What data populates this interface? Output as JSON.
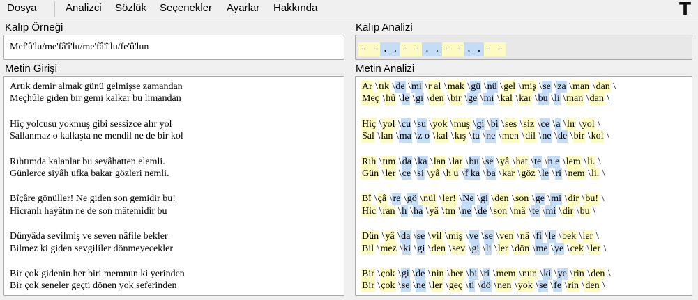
{
  "menu": {
    "items": [
      "Dosya",
      "Analizci",
      "Sözlük",
      "Seçenekler",
      "Ayarlar",
      "Hakkında"
    ],
    "right_icon": "T"
  },
  "kalip_ornegi": {
    "label": "Kalıp Örneği",
    "value": "Mef'û'lu/me'fâ'î'lu/me'fâ'î'lu/fe'û'lun"
  },
  "kalip_analizi": {
    "label": "Kalıp Analizi",
    "pattern": [
      "- -",
      ".",
      ".",
      "- -",
      ".",
      ".",
      "- -",
      ".",
      ".",
      "- -"
    ]
  },
  "metin_girisi": {
    "label": "Metin Girişi",
    "stanzas": [
      [
        "Artık demir almak günü gelmişse zamandan",
        "Meçhûle giden bir gemi kalkar bu limandan"
      ],
      [
        "Hiç yolcusu yokmuş gibi sessizce alır yol",
        "Sallanmaz o kalkışta ne mendil ne de bir kol"
      ],
      [
        "Rıhtımda kalanlar bu seyâhatten elemli.",
        "Günlerce siyâh ufka bakar gözleri nemli."
      ],
      [
        "Bîçâre gönüller! Ne giden son gemidir bu!",
        "Hicranlı hayâtın ne de son mâtemidir bu"
      ],
      [
        "Dünyâda sevilmiş ve seven nâfile bekler",
        "Bilmez ki giden sevgililer dönmeyecekler"
      ],
      [
        "Bir çok gidenin her biri memnun ki yerinden",
        "Bir çok seneler geçti dönen yok seferinden"
      ]
    ]
  },
  "metin_analizi": {
    "label": "Metin Analizi",
    "stanzas": [
      [
        [
          "Ar",
          "tık",
          "de",
          "mi",
          "r al",
          "mak",
          "gü",
          "nü",
          "gel",
          "miş",
          "se",
          "za",
          "man",
          "dan"
        ],
        [
          "Meç",
          "hû",
          "le",
          "gi",
          "den",
          "bir",
          "ge",
          "mi",
          "kal",
          "kar",
          "bu",
          "li",
          "man",
          "dan"
        ]
      ],
      [
        [
          "Hiç",
          "yol",
          "cu",
          "su",
          "yok",
          "muş",
          "gi",
          "bi",
          "ses",
          "siz",
          "ce",
          "a",
          "lır",
          "yol"
        ],
        [
          "Sal",
          "lan",
          "ma",
          "z o",
          "kal",
          "kış",
          "ta",
          "ne",
          "men",
          "dil",
          "ne",
          "de",
          "bir",
          "kol"
        ]
      ],
      [
        [
          "Rıh",
          "tım",
          "da",
          "ka",
          "lan",
          "lar",
          "bu",
          "se",
          "yâ",
          "hat",
          "te",
          "n e",
          "lem",
          "li."
        ],
        [
          "Gün",
          "ler",
          "ce",
          "si",
          "yâ",
          "h u",
          "f ka",
          "ba",
          "kar",
          "göz",
          "le",
          "ri",
          "nem",
          "li."
        ]
      ],
      [
        [
          "Bî",
          "çâ",
          "re",
          "gö",
          "nül",
          "ler!",
          "Ne",
          "gi",
          "den",
          "son",
          "ge",
          "mi",
          "dir",
          "bu!"
        ],
        [
          "Hic",
          "ran",
          "lı",
          "ha",
          "yâ",
          "tın",
          "ne",
          "de",
          "son",
          "mâ",
          "te",
          "mi",
          "dir",
          "bu"
        ]
      ],
      [
        [
          "Dün",
          "yâ",
          "da",
          "se",
          "vil",
          "miş",
          "ve",
          "se",
          "ven",
          "nâ",
          "fi",
          "le",
          "bek",
          "ler"
        ],
        [
          "Bil",
          "mez",
          "ki",
          "gi",
          "den",
          "sev",
          "gi",
          "li",
          "ler",
          "dön",
          "me",
          "ye",
          "cek",
          "ler"
        ]
      ],
      [
        [
          "Bir",
          "çok",
          "gi",
          "de",
          "nin",
          "her",
          "bi",
          "ri",
          "mem",
          "nun",
          "ki",
          "ye",
          "rin",
          "den"
        ],
        [
          "Bir",
          "çok",
          "se",
          "ne",
          "ler",
          "geç",
          "ti",
          "dö",
          "nen",
          "yok",
          "se",
          "fe",
          "rin",
          "den"
        ]
      ]
    ]
  }
}
